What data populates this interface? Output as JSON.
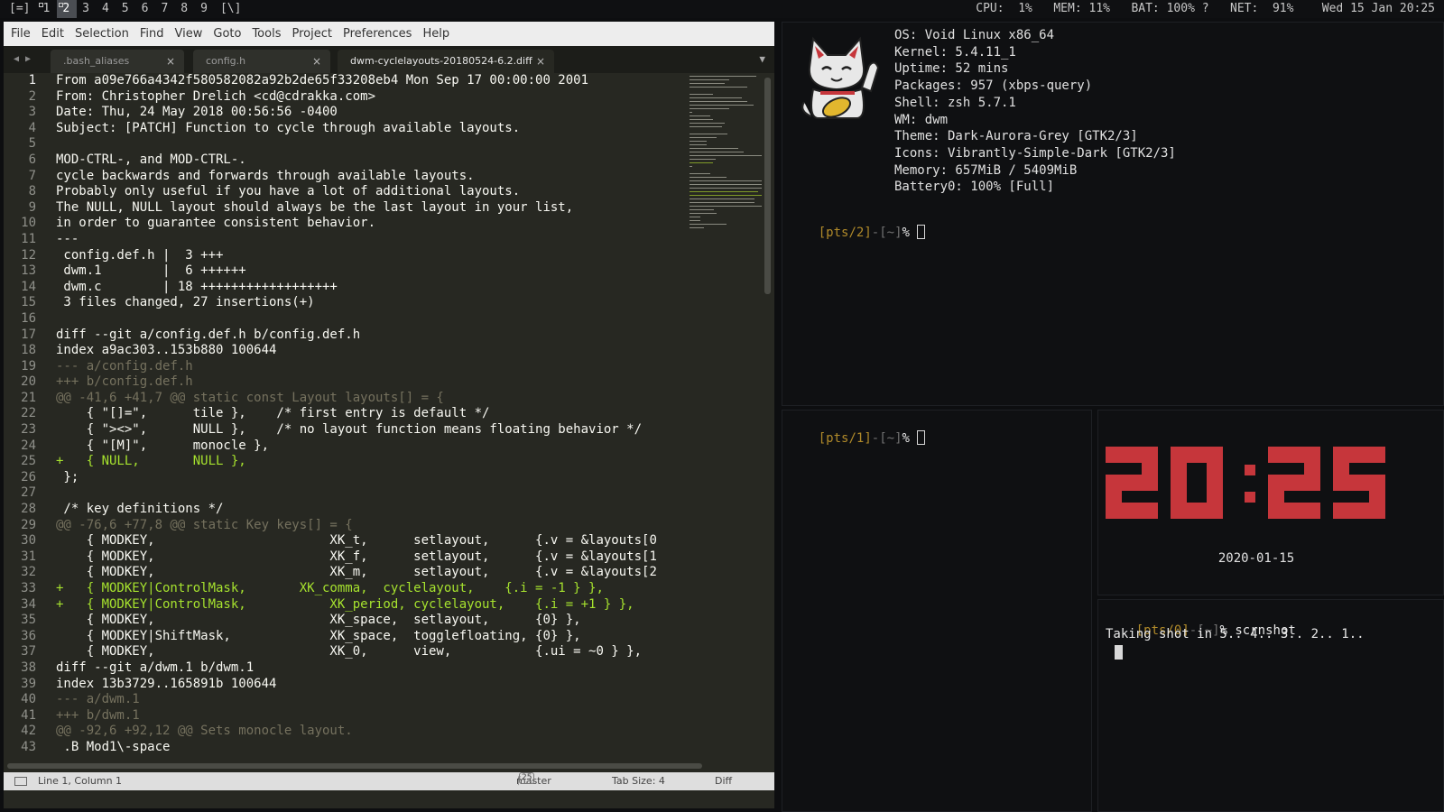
{
  "topbar": {
    "tags": [
      "[=]",
      "1",
      "2",
      "3",
      "4",
      "5",
      "6",
      "7",
      "8",
      "9",
      "[\\]"
    ],
    "active_tag": "2",
    "stats": "CPU:  1%   MEM: 11%   BAT: 100% ?   NET:  91%    Wed 15 Jan 20:25"
  },
  "editor": {
    "menu": [
      "File",
      "Edit",
      "Selection",
      "Find",
      "View",
      "Goto",
      "Tools",
      "Project",
      "Preferences",
      "Help"
    ],
    "tabs": [
      {
        "label": ".bash_aliases",
        "close": "×"
      },
      {
        "label": "config.h",
        "close": "×"
      },
      {
        "label": "dwm-cyclelayouts-20180524-6.2.diff",
        "close": "×"
      }
    ],
    "lines": [
      {
        "n": "1",
        "t": "From a09e766a4342f580582082a92b2de65f33208eb4 Mon Sep 17 00:00:00 2001",
        "k": ""
      },
      {
        "n": "2",
        "t": "From: Christopher Drelich <cd@cdrakka.com>",
        "k": ""
      },
      {
        "n": "3",
        "t": "Date: Thu, 24 May 2018 00:56:56 -0400",
        "k": ""
      },
      {
        "n": "4",
        "t": "Subject: [PATCH] Function to cycle through available layouts.",
        "k": ""
      },
      {
        "n": "5",
        "t": "",
        "k": ""
      },
      {
        "n": "6",
        "t": "MOD-CTRL-, and MOD-CTRL-.",
        "k": ""
      },
      {
        "n": "7",
        "t": "cycle backwards and forwards through available layouts.",
        "k": ""
      },
      {
        "n": "8",
        "t": "Probably only useful if you have a lot of additional layouts.",
        "k": ""
      },
      {
        "n": "9",
        "t": "The NULL, NULL layout should always be the last layout in your list,",
        "k": ""
      },
      {
        "n": "10",
        "t": "in order to guarantee consistent behavior.",
        "k": ""
      },
      {
        "n": "11",
        "t": "---",
        "k": ""
      },
      {
        "n": "12",
        "t": " config.def.h |  3 +++",
        "k": ""
      },
      {
        "n": "13",
        "t": " dwm.1        |  6 ++++++",
        "k": ""
      },
      {
        "n": "14",
        "t": " dwm.c        | 18 ++++++++++++++++++",
        "k": ""
      },
      {
        "n": "15",
        "t": " 3 files changed, 27 insertions(+)",
        "k": ""
      },
      {
        "n": "16",
        "t": "",
        "k": ""
      },
      {
        "n": "17",
        "t": "diff --git a/config.def.h b/config.def.h",
        "k": ""
      },
      {
        "n": "18",
        "t": "index a9ac303..153b880 100644",
        "k": ""
      },
      {
        "n": "19",
        "t": "--- a/config.def.h",
        "k": "meta"
      },
      {
        "n": "20",
        "t": "+++ b/config.def.h",
        "k": "meta"
      },
      {
        "n": "21",
        "t": "@@ -41,6 +41,7 @@ static const Layout layouts[] = {",
        "k": "meta"
      },
      {
        "n": "22",
        "t": "    { \"[]=\",      tile },    /* first entry is default */",
        "k": ""
      },
      {
        "n": "23",
        "t": "    { \"><>\",      NULL },    /* no layout function means floating behavior */",
        "k": ""
      },
      {
        "n": "24",
        "t": "    { \"[M]\",      monocle },",
        "k": ""
      },
      {
        "n": "25",
        "t": "+   { NULL,       NULL },",
        "k": "add"
      },
      {
        "n": "26",
        "t": " };",
        "k": ""
      },
      {
        "n": "27",
        "t": "",
        "k": ""
      },
      {
        "n": "28",
        "t": " /* key definitions */",
        "k": ""
      },
      {
        "n": "29",
        "t": "@@ -76,6 +77,8 @@ static Key keys[] = {",
        "k": "meta"
      },
      {
        "n": "30",
        "t": "    { MODKEY,                       XK_t,      setlayout,      {.v = &layouts[0",
        "k": ""
      },
      {
        "n": "31",
        "t": "    { MODKEY,                       XK_f,      setlayout,      {.v = &layouts[1",
        "k": ""
      },
      {
        "n": "32",
        "t": "    { MODKEY,                       XK_m,      setlayout,      {.v = &layouts[2",
        "k": ""
      },
      {
        "n": "33",
        "t": "+   { MODKEY|ControlMask,       XK_comma,  cyclelayout,    {.i = -1 } },",
        "k": "add"
      },
      {
        "n": "34",
        "t": "+   { MODKEY|ControlMask,           XK_period, cyclelayout,    {.i = +1 } },",
        "k": "add"
      },
      {
        "n": "35",
        "t": "    { MODKEY,                       XK_space,  setlayout,      {0} },",
        "k": ""
      },
      {
        "n": "36",
        "t": "    { MODKEY|ShiftMask,             XK_space,  togglefloating, {0} },",
        "k": ""
      },
      {
        "n": "37",
        "t": "    { MODKEY,                       XK_0,      view,           {.ui = ~0 } },",
        "k": ""
      },
      {
        "n": "38",
        "t": "diff --git a/dwm.1 b/dwm.1",
        "k": ""
      },
      {
        "n": "39",
        "t": "index 13b3729..165891b 100644",
        "k": ""
      },
      {
        "n": "40",
        "t": "--- a/dwm.1",
        "k": "meta"
      },
      {
        "n": "41",
        "t": "+++ b/dwm.1",
        "k": "meta"
      },
      {
        "n": "42",
        "t": "@@ -92,6 +92,12 @@ Sets monocle layout.",
        "k": "meta"
      },
      {
        "n": "43",
        "t": " .B Mod1\\-space",
        "k": ""
      }
    ],
    "status": {
      "position": "Line 1, Column 1",
      "branch": "master",
      "branch_count": "25",
      "tab_size": "Tab Size: 4",
      "syntax": "Diff"
    }
  },
  "fetch": {
    "info": [
      "OS: Void Linux x86_64",
      "Kernel: 5.4.11_1",
      "Uptime: 52 mins",
      "Packages: 957 (xbps-query)",
      "Shell: zsh 5.7.1",
      "WM: dwm",
      "Theme: Dark-Aurora-Grey [GTK2/3]",
      "Icons: Vibrantly-Simple-Dark [GTK2/3]",
      "Memory: 657MiB / 5409MiB",
      "Battery0: 100% [Full]"
    ],
    "prompt": {
      "tty": "pts/2",
      "dir": "~",
      "sym": "%"
    }
  },
  "term1": {
    "prompt": {
      "tty": "pts/1",
      "dir": "~",
      "sym": "%"
    }
  },
  "term0": {
    "prompt": {
      "tty": "pts/0",
      "dir": "~",
      "sym": "%"
    },
    "command": "scrnshot",
    "output": "Taking shot in 5.. 4.. 3.. 2.. 1.."
  },
  "clock": {
    "time": "20:25",
    "date": "2020-01-15",
    "color": "#c6363b"
  }
}
